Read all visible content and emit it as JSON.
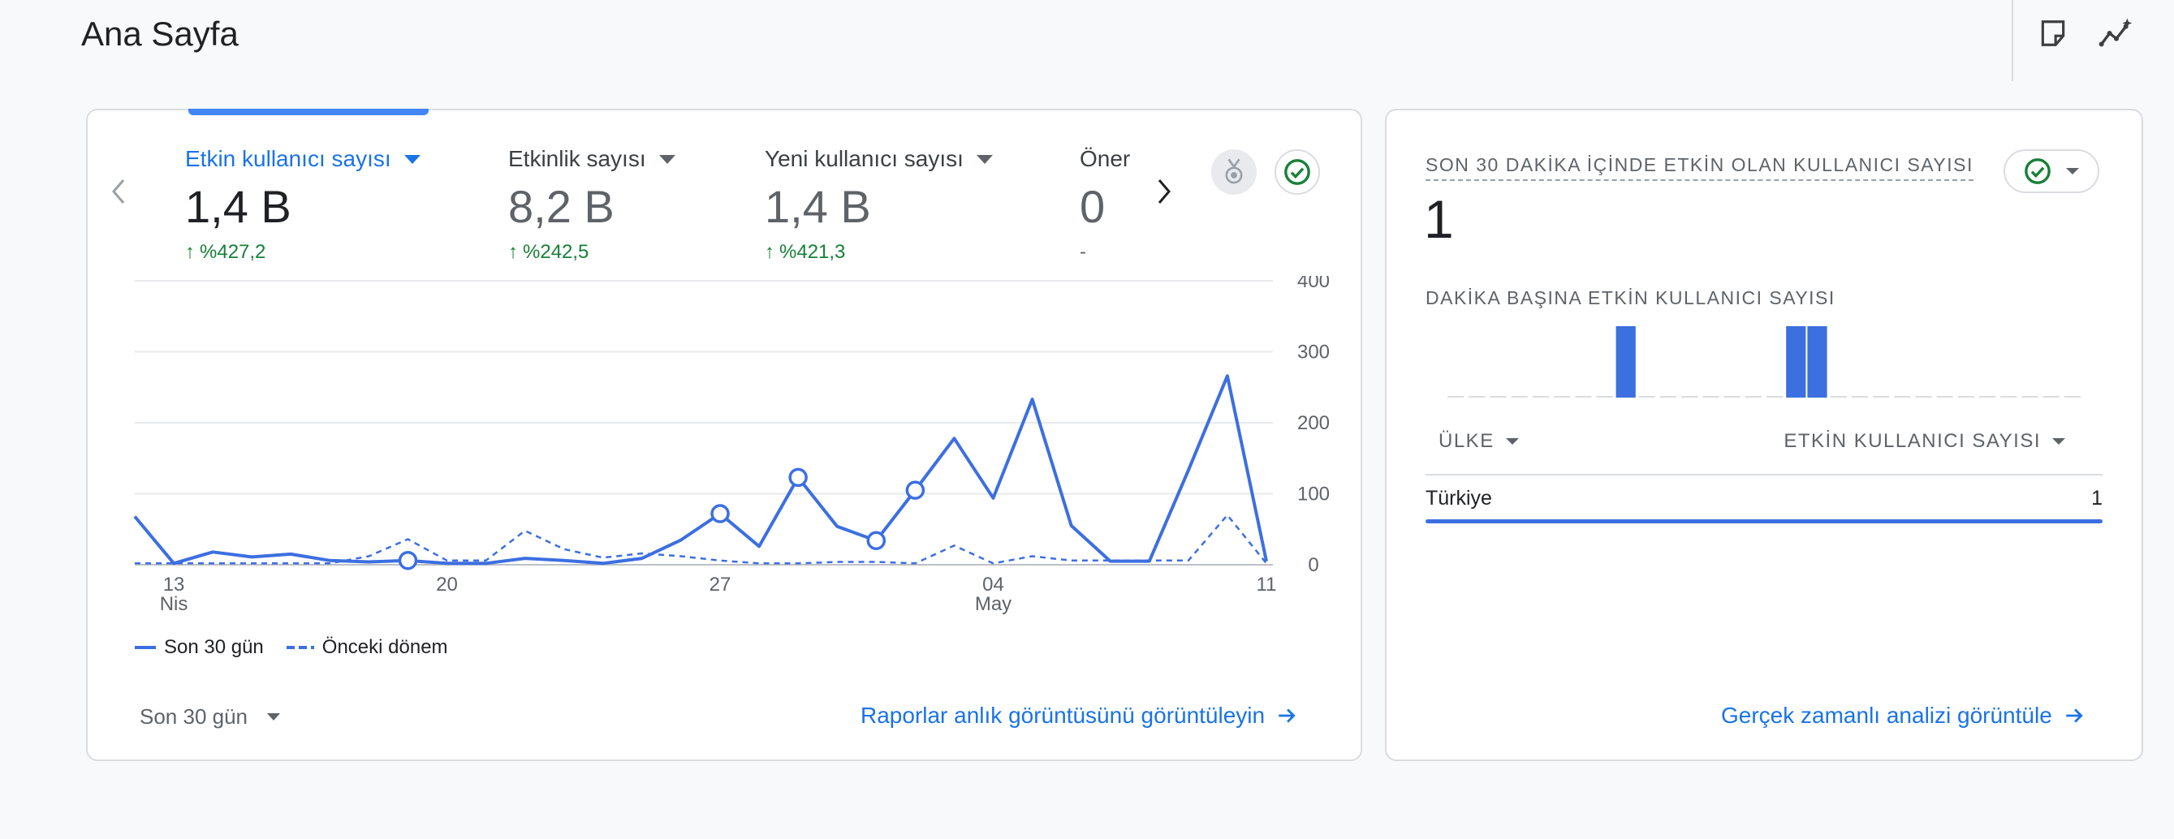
{
  "header": {
    "title": "Ana Sayfa"
  },
  "metrics": [
    {
      "label": "Etkin kullanıcı sayısı",
      "value": "1,4 B",
      "delta": "%427,2",
      "active": true
    },
    {
      "label": "Etkinlik sayısı",
      "value": "8,2 B",
      "delta": "%242,5",
      "active": false
    },
    {
      "label": "Yeni kullanıcı sayısı",
      "value": "1,4 B",
      "delta": "%421,3",
      "active": false
    },
    {
      "label": "Öner",
      "value": "0",
      "delta": "-",
      "active": false
    }
  ],
  "chart_data": {
    "type": "line",
    "x_ticks": [
      {
        "index": 1,
        "label": "13",
        "sublabel": "Nis"
      },
      {
        "index": 8,
        "label": "20",
        "sublabel": ""
      },
      {
        "index": 15,
        "label": "27",
        "sublabel": ""
      },
      {
        "index": 22,
        "label": "04",
        "sublabel": "May"
      },
      {
        "index": 29,
        "label": "11",
        "sublabel": ""
      }
    ],
    "y_ticks": [
      "400",
      "300",
      "200",
      "100",
      "0"
    ],
    "ylim": [
      0,
      400
    ],
    "series": [
      {
        "name": "Son 30 gün",
        "style": "solid",
        "color": "#3c6fe0",
        "values": [
          68,
          2,
          18,
          11,
          15,
          6,
          4,
          6,
          2,
          2,
          9,
          6,
          2,
          9,
          35,
          72,
          26,
          123,
          54,
          34,
          105,
          178,
          94,
          233,
          55,
          5,
          5,
          133,
          266,
          5
        ]
      },
      {
        "name": "Önceki dönem",
        "style": "dashed",
        "color": "#3c6fe0",
        "values": [
          2,
          2,
          2,
          2,
          2,
          2,
          12,
          36,
          6,
          6,
          48,
          22,
          10,
          16,
          12,
          6,
          2,
          2,
          4,
          4,
          2,
          27,
          2,
          12,
          6,
          6,
          6,
          6,
          70,
          2
        ]
      }
    ],
    "markers": [
      7,
      15,
      17,
      19,
      20
    ],
    "legend": [
      {
        "name": "Son 30 gün",
        "style": "solid"
      },
      {
        "name": "Önceki dönem",
        "style": "dashed"
      }
    ]
  },
  "footer": {
    "range_label": "Son 30 gün",
    "reports_link": "Raporlar anlık görüntüsünü görüntüleyin"
  },
  "realtime": {
    "heading": "SON 30 DAKİKA İÇİNDE ETKİN OLAN KULLANICI SAYISI",
    "count": "1",
    "subheading": "DAKİKA BAŞINA ETKİN KULLANICI SAYISI",
    "bars": [
      0,
      0,
      0,
      0,
      0,
      0,
      0,
      0,
      1,
      0,
      0,
      0,
      0,
      0,
      0,
      0,
      1,
      1,
      0,
      0,
      0,
      0,
      0,
      0,
      0,
      0,
      0,
      0,
      0,
      0
    ],
    "col_country": "ÜLKE",
    "col_users": "ETKİN KULLANICI SAYISI",
    "rows": [
      {
        "country": "Türkiye",
        "value": "1"
      }
    ],
    "link": "Gerçek zamanlı analizi görüntüle"
  },
  "colors": {
    "accent": "#1a73e8",
    "line": "#3c6fe0",
    "positive": "#188038"
  }
}
